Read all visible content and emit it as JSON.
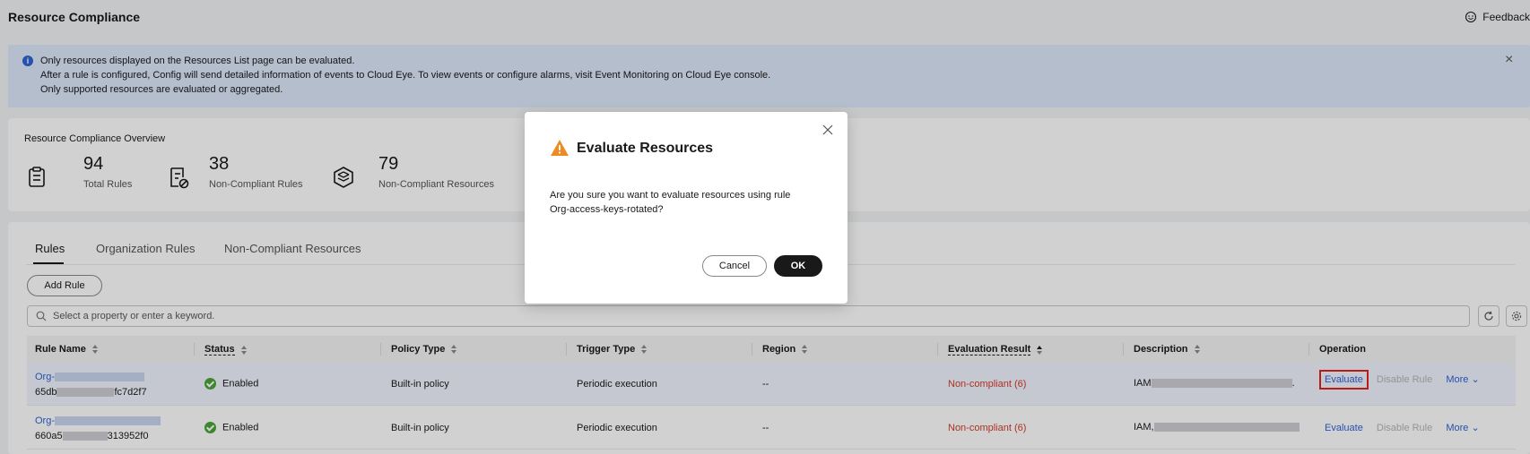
{
  "header": {
    "title": "Resource Compliance",
    "feedback_label": "Feedback"
  },
  "alert": {
    "lines": [
      "Only resources displayed on the Resources List page can be evaluated.",
      "After a rule is configured, Config will send detailed information of events to Cloud Eye. To view events or configure alarms, visit Event Monitoring on Cloud Eye console.",
      "Only supported resources are evaluated or aggregated."
    ]
  },
  "overview": {
    "title": "Resource Compliance Overview",
    "stats": [
      {
        "value": "94",
        "label": "Total Rules",
        "icon": "clipboard-icon"
      },
      {
        "value": "38",
        "label": "Non-Compliant Rules",
        "icon": "noncompliant-doc-icon"
      },
      {
        "value": "79",
        "label": "Non-Compliant Resources",
        "icon": "layers-icon"
      }
    ]
  },
  "tabs": [
    "Rules",
    "Organization Rules",
    "Non-Compliant Resources"
  ],
  "toolbar": {
    "add_rule_label": "Add Rule"
  },
  "search": {
    "placeholder": "Select a property or enter a keyword."
  },
  "table": {
    "columns": [
      "Rule Name",
      "Status",
      "Policy Type",
      "Trigger Type",
      "Region",
      "Evaluation Result",
      "Description",
      "Operation"
    ],
    "rows": [
      {
        "name_prefix": "Org-",
        "id_prefix": "65db",
        "id_suffix": "fc7d2f7",
        "status": "Enabled",
        "policy_type": "Built-in policy",
        "trigger_type": "Periodic execution",
        "region": "--",
        "evaluation_result": "Non-compliant (6)",
        "desc_prefix": "IAM",
        "desc_suffix": ".",
        "op_evaluate": "Evaluate",
        "op_disable": "Disable Rule",
        "op_more": "More"
      },
      {
        "name_prefix": "Org-",
        "id_prefix": "660a5",
        "id_suffix": "313952f0",
        "status": "Enabled",
        "policy_type": "Built-in policy",
        "trigger_type": "Periodic execution",
        "region": "--",
        "evaluation_result": "Non-compliant (6)",
        "desc_prefix": "IAM,",
        "desc_suffix": "",
        "op_evaluate": "Evaluate",
        "op_disable": "Disable Rule",
        "op_more": "More"
      }
    ]
  },
  "dialog": {
    "title": "Evaluate Resources",
    "body": "Are you sure you want to evaluate resources using rule Org-access-keys-rotated?",
    "cancel_label": "Cancel",
    "ok_label": "OK"
  },
  "colors": {
    "accent": "#2e63d6",
    "danger": "#d33a2c",
    "success": "#4aa537",
    "warning": "#f08a24",
    "primary_button": "#191919"
  }
}
